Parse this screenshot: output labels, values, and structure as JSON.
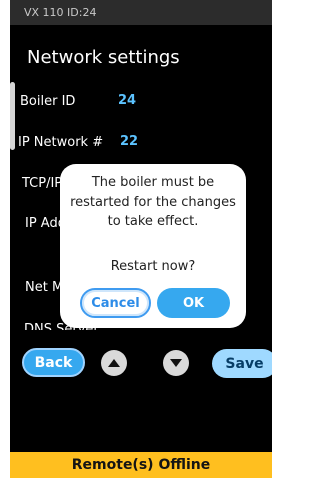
{
  "header": {
    "device_info": "VX 110  ID:24"
  },
  "page": {
    "title": "Network settings"
  },
  "settings": [
    {
      "label": "Boiler ID",
      "value": "24"
    },
    {
      "label": "IP Network #",
      "value": "22"
    },
    {
      "label": "TCP/IP",
      "value": ""
    },
    {
      "label": "IP Address",
      "value": ""
    },
    {
      "label": "Net Mask",
      "value": ""
    },
    {
      "label": "DNS Server",
      "value": ""
    }
  ],
  "dialog": {
    "message": "The boiler must be restarted for the changes to take effect.",
    "question": "Restart now?",
    "cancel_label": "Cancel",
    "ok_label": "OK"
  },
  "nav": {
    "back_label": "Back",
    "save_label": "Save",
    "up_icon": "chevron-up-icon",
    "down_icon": "chevron-down-icon"
  },
  "status": {
    "text": "Remote(s) Offline"
  },
  "colors": {
    "accent": "#36a8ef",
    "value_text": "#5cc3ff",
    "status_bar": "#ffbf1f",
    "save_button": "#9fd9ff"
  }
}
